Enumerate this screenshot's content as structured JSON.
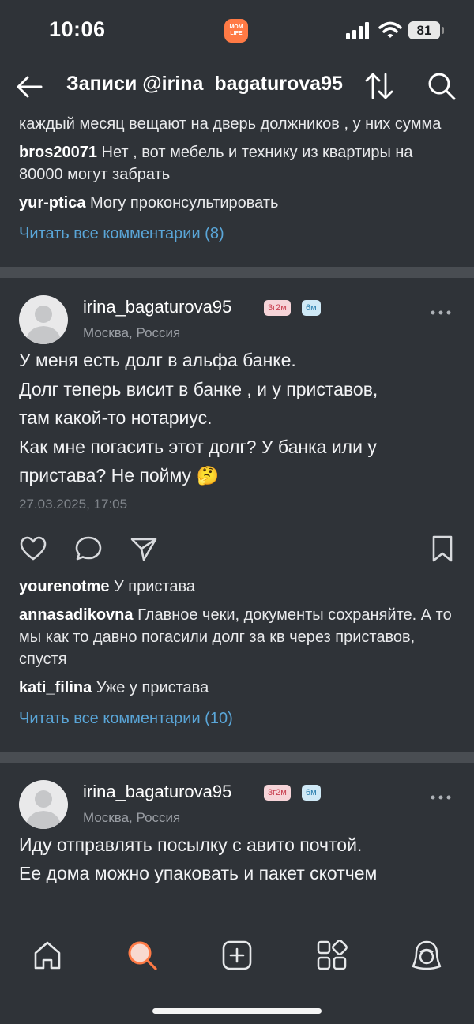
{
  "status_bar": {
    "time": "10:06",
    "app_badge_line1": "MOM",
    "app_badge_line2": "LIFE",
    "battery": "81"
  },
  "header": {
    "title": "Записи @irina_bagaturova95",
    "back_icon": "arrow-left-icon",
    "sort_icon": "sort-arrows-icon",
    "search_icon": "search-icon"
  },
  "top_fragment": {
    "comments": [
      {
        "author": "",
        "text": "каждый месяц вещают на дверь должников , у них сумма"
      },
      {
        "author": "bros20071",
        "text": "Нет , вот мебель и технику из квартиры на 80000 могут забрать"
      },
      {
        "author": "yur-ptica",
        "text": "Могу проконсультировать"
      }
    ],
    "read_all": "Читать все комментарии (8)"
  },
  "posts": [
    {
      "username": "irina_bagaturova95",
      "badge1": "3г2м",
      "badge2": "6м",
      "location": "Москва, Россия",
      "text_lines": [
        "У меня есть долг в альфа банке.",
        "Долг теперь висит в банке , и  у приставов,",
        "там какой-то нотариус.",
        "Как мне погасить этот долг? У банка  или у",
        "пристава? Не пойму 🤔"
      ],
      "date": "27.03.2025, 17:05",
      "comments": [
        {
          "author": "yourenotme",
          "text": "У пристава"
        },
        {
          "author": "annasadikovna",
          "text": "Главное чеки, документы сохраняйте. А то мы как то давно погасили долг за кв через приставов, спустя"
        },
        {
          "author": "kati_filina",
          "text": "Уже у пристава"
        }
      ],
      "read_all": "Читать все комментарии (10)"
    },
    {
      "username": "irina_bagaturova95",
      "badge1": "3г2м",
      "badge2": "6м",
      "location": "Москва, Россия",
      "text_lines": [
        "Иду отправлять посылку с авито почтой.",
        "Ее дома можно упаковать и пакет скотчем"
      ]
    }
  ],
  "bottom_nav": [
    {
      "icon": "home-icon"
    },
    {
      "icon": "search-active-icon"
    },
    {
      "icon": "add-post-icon"
    },
    {
      "icon": "services-grid-icon"
    },
    {
      "icon": "profile-icon"
    }
  ],
  "colors": {
    "background": "#2f3338",
    "divider": "#494d52",
    "link": "#5aa6d8",
    "accent": "#ff7a45"
  }
}
